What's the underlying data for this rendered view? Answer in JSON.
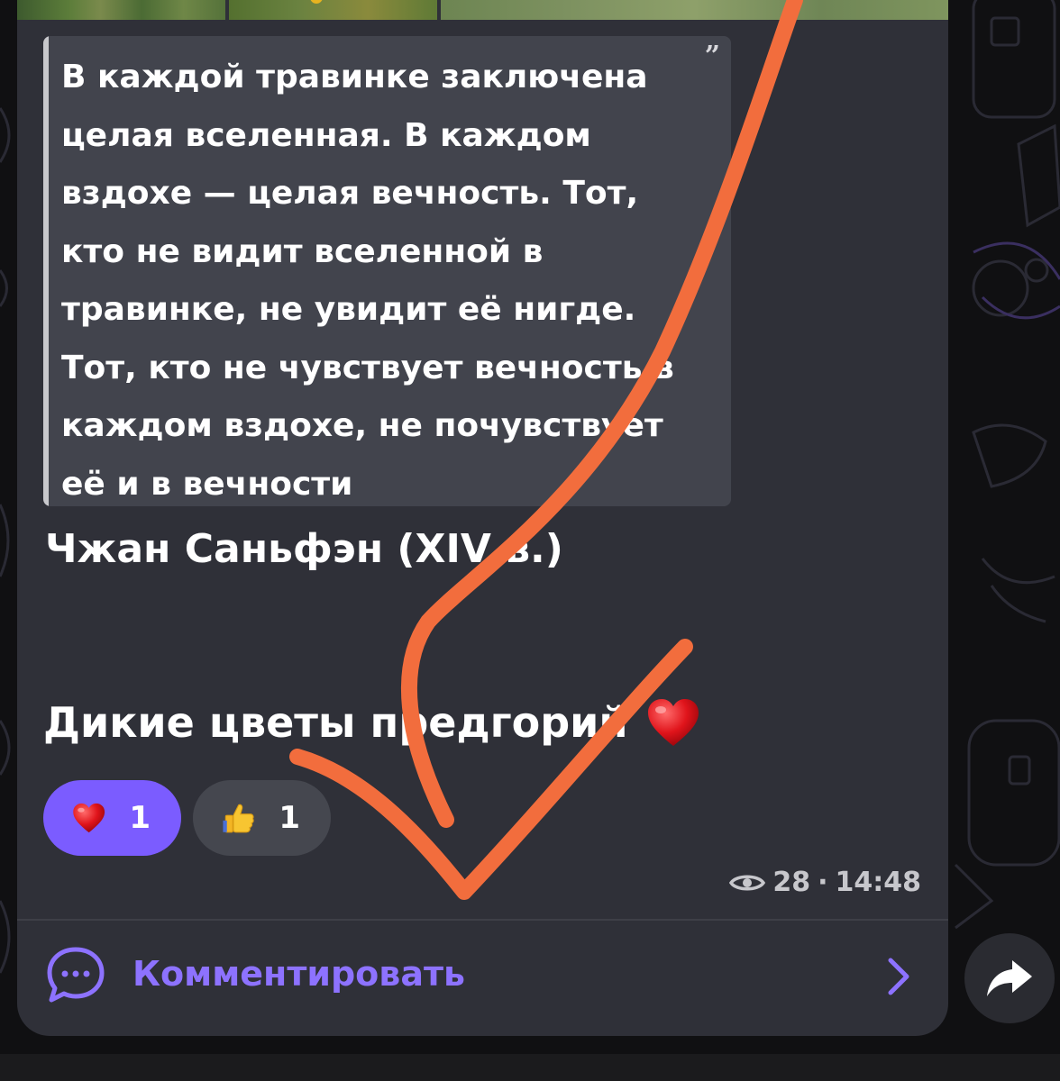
{
  "post": {
    "quote_mark": "”",
    "quote_lines": [
      "В каждой травинке заключена",
      "целая вселенная. В каждом",
      "вздохе — целая вечность. Тот,",
      "кто не видит вселенной в",
      "травинке, не увидит её нигде.",
      "Тот, кто не чувствует вечность в",
      "каждом вздохе, не почувствует",
      "её и в вечности"
    ],
    "author": "Чжан Саньфэн (XIV в.)",
    "caption": "Дикие цветы предгорий",
    "caption_emoji": "red-heart-emoji"
  },
  "reactions": [
    {
      "emoji": "red-heart-emoji",
      "count": "1",
      "chosen": true
    },
    {
      "emoji": "thumbs-up-emoji",
      "count": "1",
      "chosen": false
    }
  ],
  "meta": {
    "views": "28",
    "separator": "·",
    "time": "14:48"
  },
  "comments": {
    "label": "Комментировать",
    "icon": "chat-bubble-icon"
  },
  "share": {
    "icon": "share-arrow-icon"
  },
  "colors": {
    "accent": "#7b5cff",
    "accent_text": "#8d72ff",
    "bubble": "#2f3038",
    "quote_bg": "#42444d",
    "annotation": "#f26d3d"
  }
}
